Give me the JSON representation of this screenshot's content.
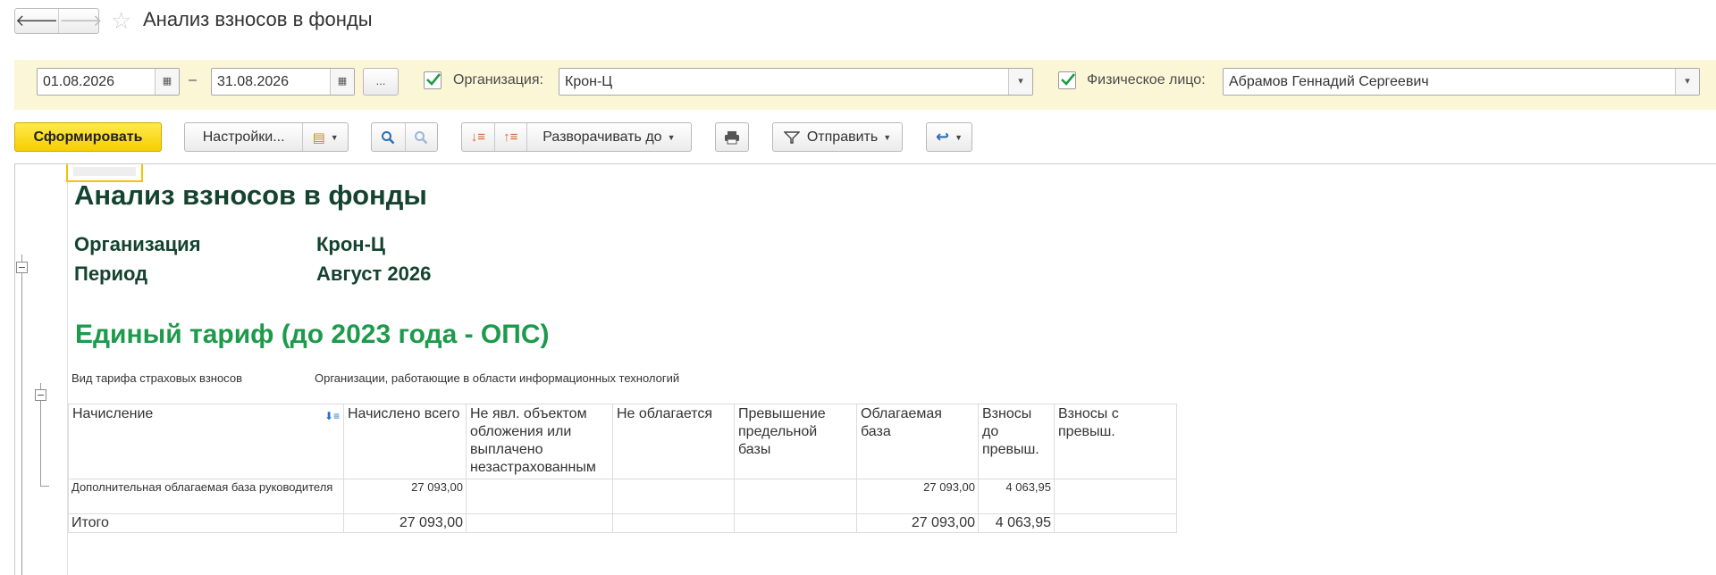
{
  "window": {
    "title": "Анализ взносов в фонды",
    "back_icon": "arrow-left-icon",
    "forward_icon": "arrow-right-icon",
    "favorite_icon": "star-icon"
  },
  "filters": {
    "date_from": "01.08.2026",
    "date_separator": "–",
    "date_to": "31.08.2026",
    "period_button": "...",
    "organization_checked": true,
    "organization_label": "Организация:",
    "organization_value": "Крон-Ц",
    "person_checked": true,
    "person_label": "Физическое лицо:",
    "person_value": "Абрамов Геннадий Сергеевич"
  },
  "toolbar": {
    "generate_label": "Сформировать",
    "settings_label": "Настройки...",
    "expand_label": "Разворачивать до",
    "send_label": "Отправить"
  },
  "report": {
    "title": "Анализ взносов в фонды",
    "org_label": "Организация",
    "org_value": "Крон-Ц",
    "period_label": "Период",
    "period_value": "Август 2026",
    "section_title": "Единый тариф (до 2023 года - ОПС)",
    "tariff_label": "Вид тарифа страховых взносов",
    "tariff_value": "Организации, работающие в области информационных технологий",
    "columns": [
      "Начисление",
      "Начислено всего",
      "Не явл. объектом обложения или выплачено незастрахованным",
      "Не облагается",
      "Превышение предельной базы",
      "Облагаемая база",
      "Взносы до превыш.",
      "Взносы с превыш."
    ],
    "rows": [
      [
        "Дополнительная облагаемая база руководителя",
        "27 093,00",
        "",
        "",
        "",
        "27 093,00",
        "4 063,95",
        ""
      ]
    ],
    "total": [
      "Итого",
      "27 093,00",
      "",
      "",
      "",
      "27 093,00",
      "4 063,95",
      ""
    ]
  },
  "colors": {
    "filter_bg": "#fbf6d6",
    "primary_button": "#f5cf00",
    "report_title": "#14432f",
    "section_title": "#1e9a4c"
  }
}
